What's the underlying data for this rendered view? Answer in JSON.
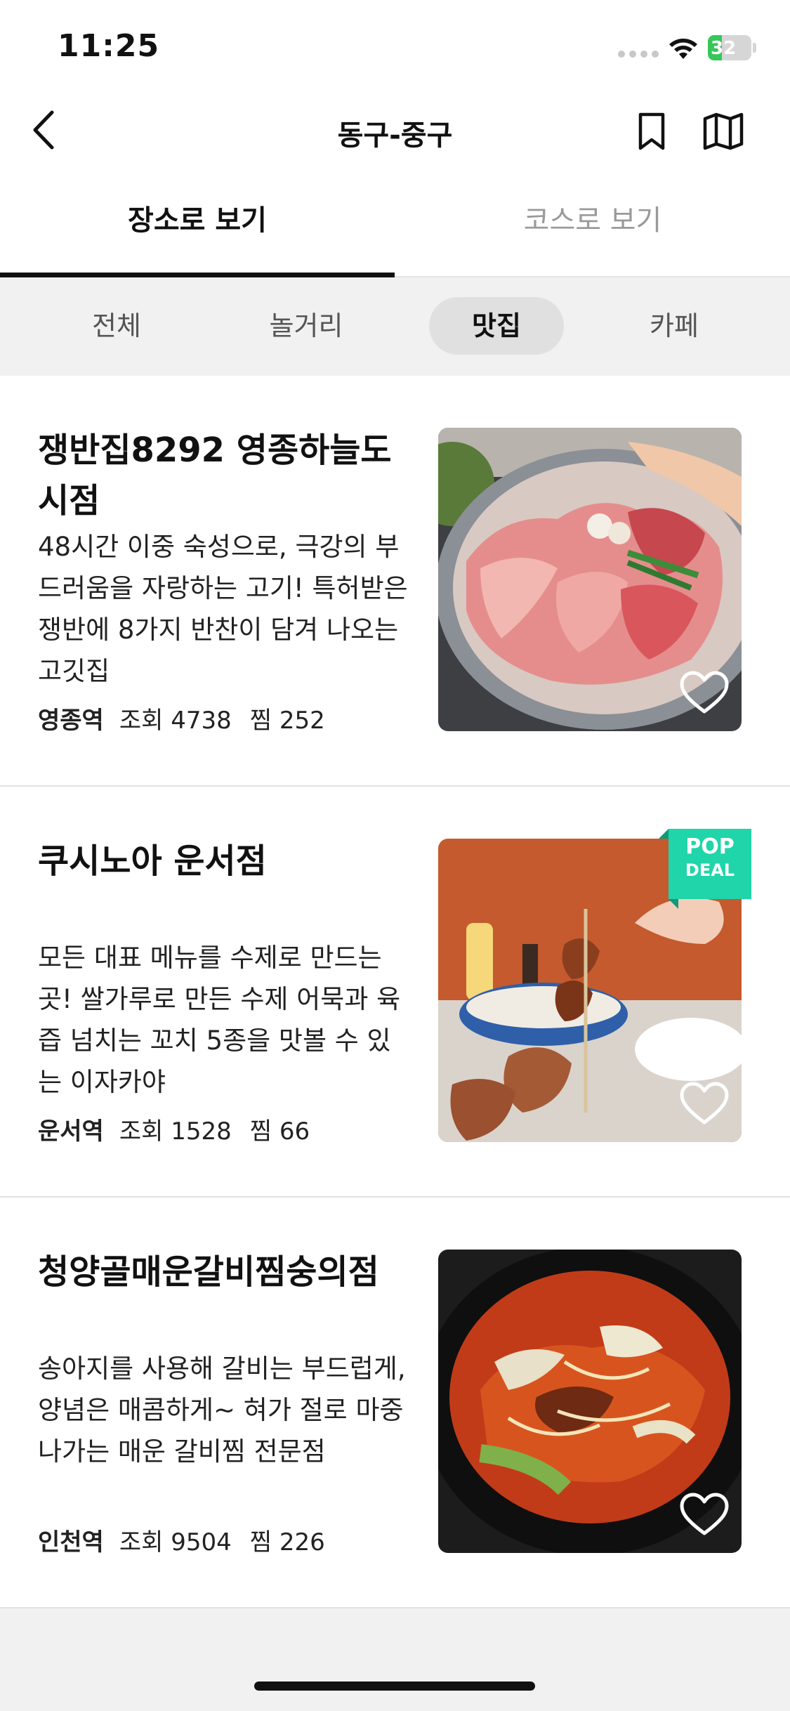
{
  "status_bar": {
    "time": "11:25",
    "battery": "32",
    "battery_level": 0.32
  },
  "header": {
    "title": "동구-중구"
  },
  "tabs": [
    {
      "label": "장소로 보기",
      "active": true
    },
    {
      "label": "코스로 보기",
      "active": false
    }
  ],
  "filters": [
    {
      "label": "전체",
      "active": false
    },
    {
      "label": "놀거리",
      "active": false
    },
    {
      "label": "맛집",
      "active": true
    },
    {
      "label": "카페",
      "active": false
    }
  ],
  "places": [
    {
      "name": "쟁반집8292 영종하늘도시점",
      "description": "48시간 이중 숙성으로, 극강의 부드러움을 자랑하는 고기! 특허받은 쟁반에 8가지 반찬이 담겨 나오는 고깃집",
      "station": "영종역",
      "views_label": "조회 4738",
      "likes_label": "찜 252",
      "badge": ""
    },
    {
      "name": "쿠시노아 운서점",
      "description": "모든 대표 메뉴를 수제로 만드는 곳! 쌀가루로 만든 수제 어묵과 육즙 넘치는 꼬치 5종을 맛볼 수 있는 이자카야",
      "station": "운서역",
      "views_label": "조회 1528",
      "likes_label": "찜 66",
      "badge_line1": "POP",
      "badge_line2": "DEAL"
    },
    {
      "name": "청양골매운갈비찜숭의점",
      "description": "송아지를 사용해 갈비는 부드럽게, 양념은 매콤하게~ 혀가 절로 마중 나가는 매운 갈비찜 전문점",
      "station": "인천역",
      "views_label": "조회 9504",
      "likes_label": "찜 226",
      "badge": ""
    }
  ],
  "colors": {
    "accent": "#111111",
    "badge": "#1fd5a9",
    "battery": "#35c759"
  }
}
